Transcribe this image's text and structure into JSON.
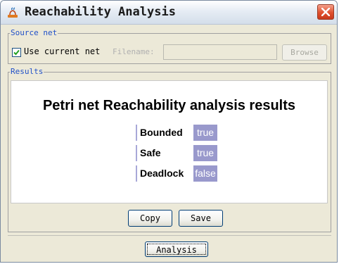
{
  "window": {
    "title": "Reachability Analysis"
  },
  "source_net": {
    "legend": "Source net",
    "use_current_label": "Use current net",
    "use_current_checked": true,
    "filename_label": "Filename:",
    "filename_value": "",
    "browse_label": "Browse"
  },
  "results": {
    "legend": "Results",
    "heading": "Petri net Reachability analysis results",
    "rows": [
      {
        "label": "Bounded",
        "value": "true"
      },
      {
        "label": "Safe",
        "value": "true"
      },
      {
        "label": "Deadlock",
        "value": "false"
      }
    ],
    "copy_label": "Copy",
    "save_label": "Save"
  },
  "footer": {
    "analysis_label": "Analysis"
  },
  "colors": {
    "value_cell": "#9999cc",
    "legend_text": "#2050c8",
    "close_button": "#e0502e"
  }
}
